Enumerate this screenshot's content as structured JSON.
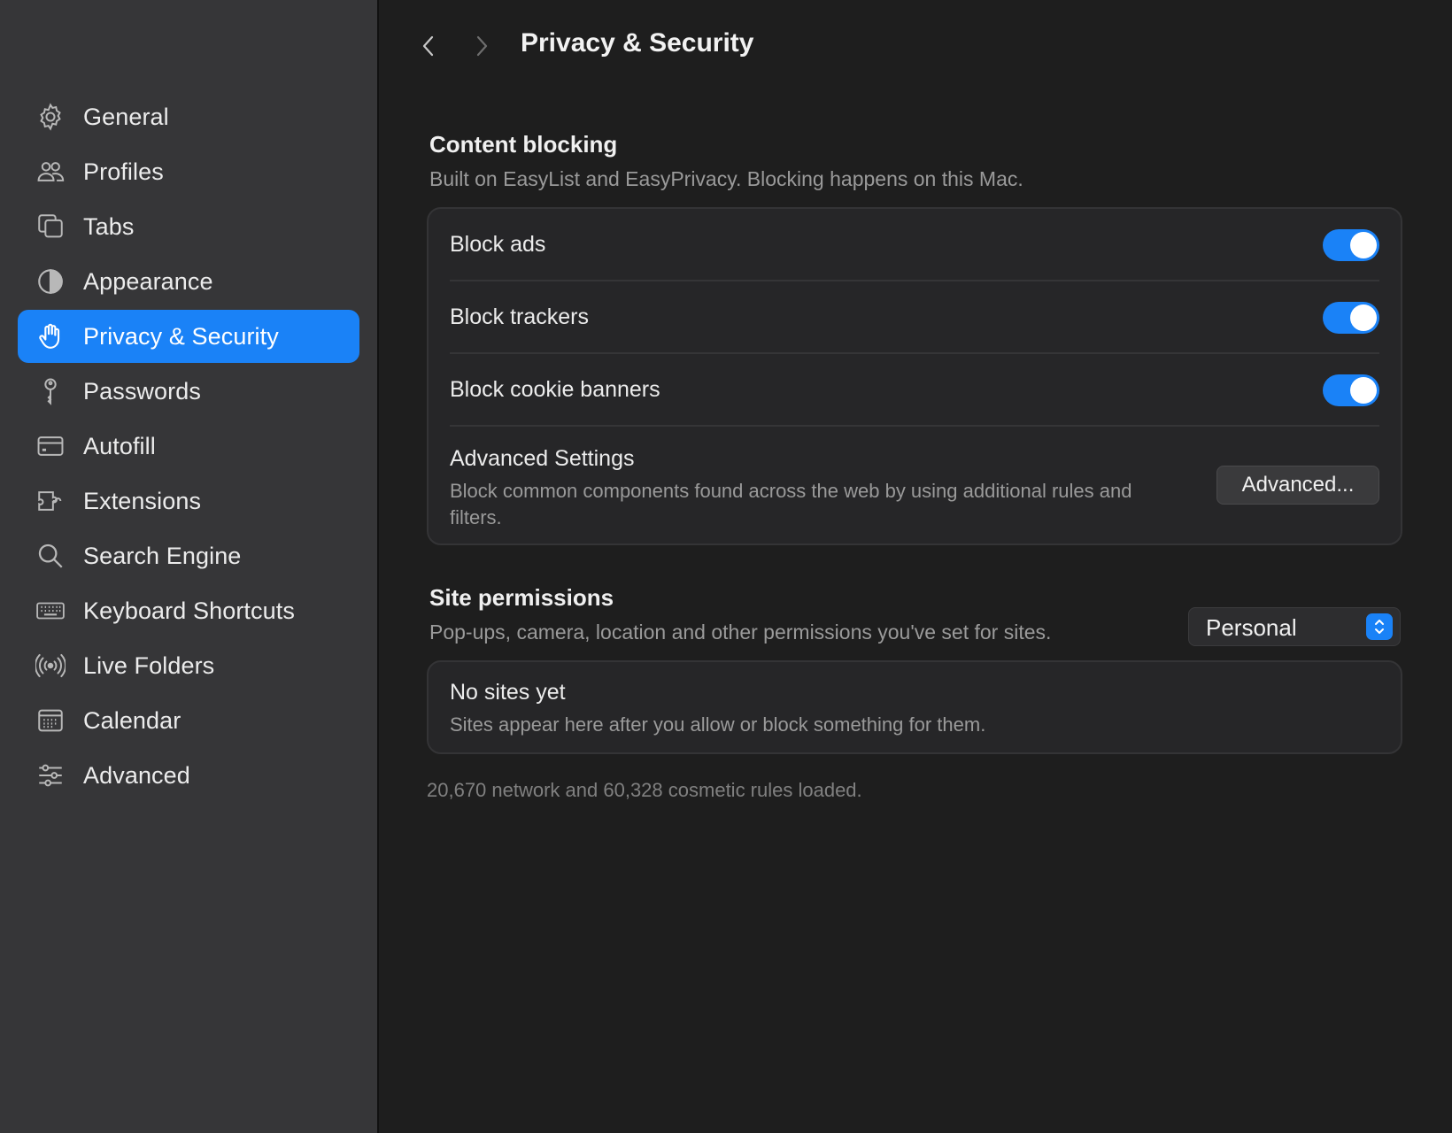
{
  "sidebar": {
    "items": [
      {
        "label": "General",
        "icon": "gear-icon"
      },
      {
        "label": "Profiles",
        "icon": "people-icon"
      },
      {
        "label": "Tabs",
        "icon": "tabs-icon"
      },
      {
        "label": "Appearance",
        "icon": "contrast-icon"
      },
      {
        "label": "Privacy & Security",
        "icon": "hand-icon",
        "active": true
      },
      {
        "label": "Passwords",
        "icon": "key-icon"
      },
      {
        "label": "Autofill",
        "icon": "card-icon"
      },
      {
        "label": "Extensions",
        "icon": "puzzle-icon"
      },
      {
        "label": "Search Engine",
        "icon": "search-icon"
      },
      {
        "label": "Keyboard Shortcuts",
        "icon": "keyboard-icon"
      },
      {
        "label": "Live Folders",
        "icon": "broadcast-icon"
      },
      {
        "label": "Calendar",
        "icon": "calendar-icon"
      },
      {
        "label": "Advanced",
        "icon": "sliders-icon"
      }
    ]
  },
  "header": {
    "title": "Privacy & Security",
    "back_icon": "chevron-left-icon",
    "forward_icon": "chevron-right-icon"
  },
  "content_blocking": {
    "title": "Content blocking",
    "subtitle": "Built on EasyList and EasyPrivacy. Blocking happens on this Mac.",
    "toggles": [
      {
        "label": "Block ads",
        "on": true
      },
      {
        "label": "Block trackers",
        "on": true
      },
      {
        "label": "Block cookie banners",
        "on": true
      }
    ],
    "advanced": {
      "title": "Advanced Settings",
      "description": "Block common components found across the web by using additional rules and filters.",
      "button_label": "Advanced..."
    }
  },
  "site_permissions": {
    "title": "Site permissions",
    "subtitle": "Pop-ups, camera, location and other permissions you've set for sites.",
    "profile_select": "Personal",
    "empty_title": "No sites yet",
    "empty_subtitle": "Sites appear here after you allow or block something for them."
  },
  "footnote": "20,670 network and 60,328 cosmetic rules loaded.",
  "colors": {
    "accent": "#1a82f7",
    "sidebar_bg": "#363638",
    "main_bg": "#1e1e1e",
    "card_bg": "#262628"
  }
}
